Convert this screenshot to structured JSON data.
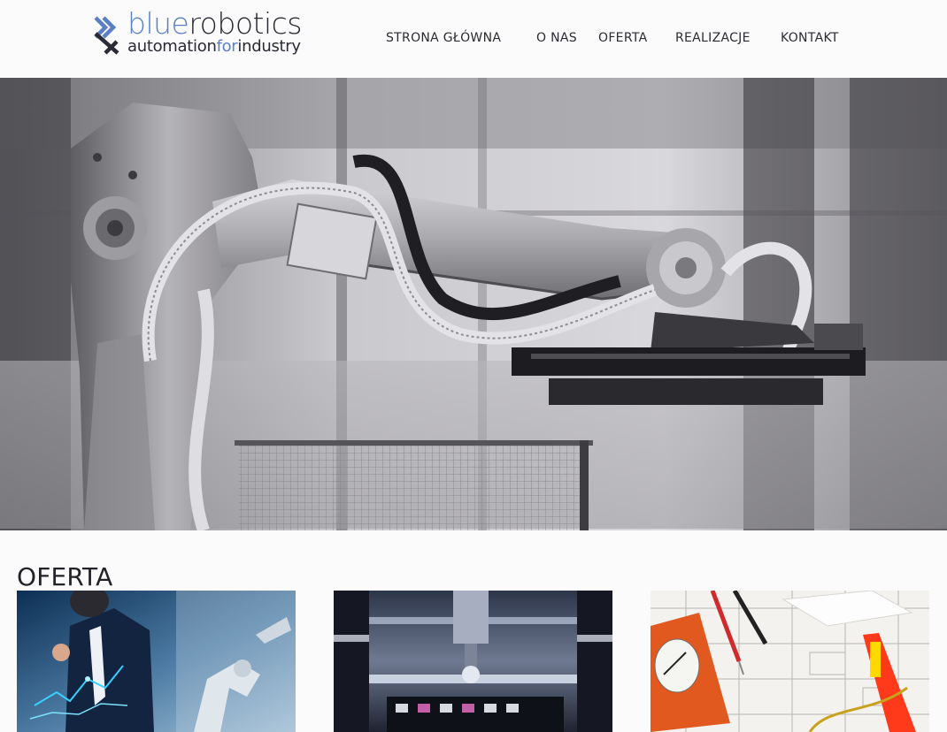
{
  "brand": {
    "word_blue": "blue",
    "word_dark": "robotics",
    "tag_1": "automation",
    "tag_2": "for",
    "tag_3": "industry",
    "primary_color": "#5b7fc6",
    "dark_color": "#2a2a35"
  },
  "nav": {
    "items": [
      {
        "label": "STRONA GŁÓWNA"
      },
      {
        "label": "O NAS"
      },
      {
        "label": "OFERTA"
      },
      {
        "label": "REALIZACJE"
      },
      {
        "label": "KONTAKT"
      }
    ]
  },
  "hero": {
    "image": "industrial-robot-arm-photo"
  },
  "offer": {
    "title": "OFERTA",
    "cards": [
      {
        "image": "businessman-digital-analytics-photo"
      },
      {
        "image": "automated-production-line-photo"
      },
      {
        "image": "multimeter-electrical-schematic-photo"
      }
    ]
  }
}
